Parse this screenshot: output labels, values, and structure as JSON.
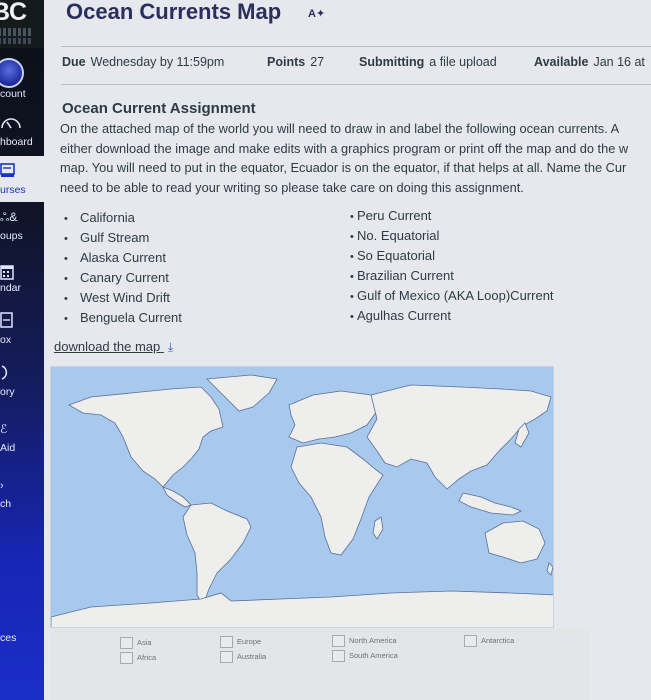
{
  "sidebar": {
    "logo": "BC",
    "items": [
      {
        "label": "count",
        "icon": "user-avatar-icon"
      },
      {
        "label": "hboard",
        "icon": "dashboard-gauge-icon"
      },
      {
        "label": "urses",
        "icon": "courses-book-icon"
      },
      {
        "label": "oups",
        "icon": "groups-people-icon"
      },
      {
        "label": "ndar",
        "icon": "calendar-icon"
      },
      {
        "label": "ox",
        "icon": "inbox-icon"
      },
      {
        "label": "ory",
        "icon": "history-clock-icon"
      },
      {
        "label": "Aid",
        "icon": "aid-icon"
      },
      {
        "label": "ch",
        "icon": "search-icon"
      },
      {
        "label": "ces",
        "icon": "resources-icon"
      }
    ]
  },
  "header": {
    "title": "Ocean Currents Map",
    "title_icon": "immersive-reader-icon"
  },
  "meta": {
    "due_label": "Due",
    "due_value": "Wednesday by 11:59pm",
    "points_label": "Points",
    "points_value": "27",
    "submitting_label": "Submitting",
    "submitting_value": "a file upload",
    "available_label": "Available",
    "available_value": "Jan 16 at"
  },
  "content": {
    "section_title": "Ocean Current Assignment",
    "paragraph_lines": [
      "On the attached map of the world you will need to draw in and label the following ocean currents.  A",
      "either download the image and make edits with a graphics program or print off the map and do the w",
      "map. You will need to put in the equator, Ecuador is on the equator, if that helps at all.  Name the Cur",
      "need to be able to read your writing so please take care on doing this assignment."
    ],
    "list_left": [
      "California",
      "Gulf Stream",
      "Alaska Current",
      "Canary Current",
      "West Wind Drift",
      "Benguela Current"
    ],
    "list_right": [
      "Peru Current",
      "No. Equatorial",
      "So Equatorial",
      "Brazilian Current",
      "Gulf of Mexico (AKA Loop)Current",
      "Agulhas Current"
    ],
    "download_link": "download the map",
    "download_icon": "download-arrow-icon"
  },
  "map": {
    "ocean_color": "#a8c9ee",
    "land_color": "#eeeeec",
    "coast_color": "#5a6e9a",
    "legend": [
      {
        "label": "Asia"
      },
      {
        "label": "Africa"
      },
      {
        "label": "Europe"
      },
      {
        "label": "Australia"
      },
      {
        "label": "North America"
      },
      {
        "label": "South America"
      },
      {
        "label": "Antarctica"
      }
    ]
  }
}
